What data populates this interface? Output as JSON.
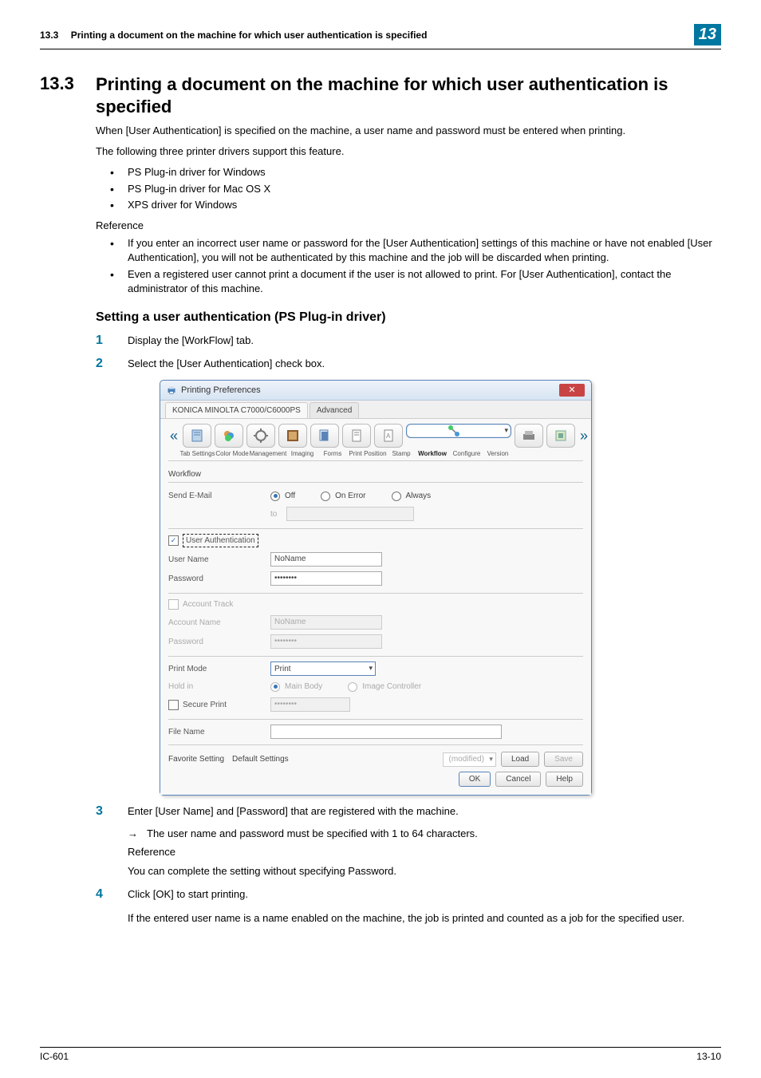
{
  "header": {
    "section_no": "13.3",
    "section_title_short": "Printing a document on the machine for which user authentication is specified",
    "chapter_badge": "13"
  },
  "section": {
    "number": "13.3",
    "title": "Printing a document on the machine for which user authentication is specified"
  },
  "intro": {
    "p1": "When [User Authentication] is specified on the machine, a user name and password must be entered when printing.",
    "p2": "The following three printer drivers support this feature.",
    "drivers": [
      "PS Plug-in driver for Windows",
      "PS Plug-in driver for Mac OS X",
      "XPS driver for Windows"
    ],
    "reference_label": "Reference",
    "ref_bullets": [
      "If you enter an incorrect user name or password for the [User Authentication] settings of this machine or have not enabled [User Authentication], you will not be authenticated by this machine and the job will be discarded when printing.",
      "Even a registered user cannot print a document if the user is not allowed to print. For [User Authentication], contact the administrator of this machine."
    ]
  },
  "subheading": "Setting a user authentication (PS Plug-in driver)",
  "steps": {
    "s1": "Display the [WorkFlow] tab.",
    "s2": "Select the [User Authentication] check box.",
    "s3": "Enter [User Name] and [Password] that are registered with the machine.",
    "s3_arrow": "The user name and password must be specified with 1 to 64 characters.",
    "s3_ref_label": "Reference",
    "s3_ref": "You can complete the setting without specifying  Password.",
    "s4": "Click [OK] to start printing.",
    "s4_sub": "If the entered user name is a name enabled on the machine, the job is printed and counted as a job for the specified user."
  },
  "dialog": {
    "title": "Printing Preferences",
    "tabs": {
      "active": "KONICA MINOLTA C7000/C6000PS",
      "other": "Advanced"
    },
    "toolbar_labels": [
      "Tab Settings",
      "Color Mode",
      "Management",
      "Imaging",
      "Forms",
      "Print Position",
      "Stamp",
      "Workflow",
      "Configure",
      "Version"
    ],
    "active_tool": "Workflow",
    "workflow_label": "Workflow",
    "sendmail": {
      "label": "Send E-Mail",
      "off": "Off",
      "on_error": "On Error",
      "always": "Always",
      "to_label": "to",
      "to_value": ""
    },
    "user_auth": {
      "label": "User Authentication",
      "user_label": "User Name",
      "user_value": "NoName",
      "pw_label": "Password",
      "pw_value": "••••••••"
    },
    "account": {
      "label": "Account Track",
      "name_label": "Account Name",
      "name_value": "NoName",
      "pw_label": "Password",
      "pw_value": "••••••••"
    },
    "printmode": {
      "label": "Print Mode",
      "value": "Print",
      "holdin_label": "Hold in",
      "main_body": "Main Body",
      "img_ctrl": "Image Controller",
      "secure_label": "Secure Print",
      "secure_value": "••••••••"
    },
    "filename_label": "File Name",
    "filename_value": "",
    "favorite": {
      "label": "Favorite Setting",
      "value": "Default Settings",
      "modified": "(modified)",
      "load": "Load",
      "save": "Save"
    },
    "buttons": {
      "ok": "OK",
      "cancel": "Cancel",
      "help": "Help"
    }
  },
  "footer": {
    "left": "IC-601",
    "right": "13-10"
  }
}
